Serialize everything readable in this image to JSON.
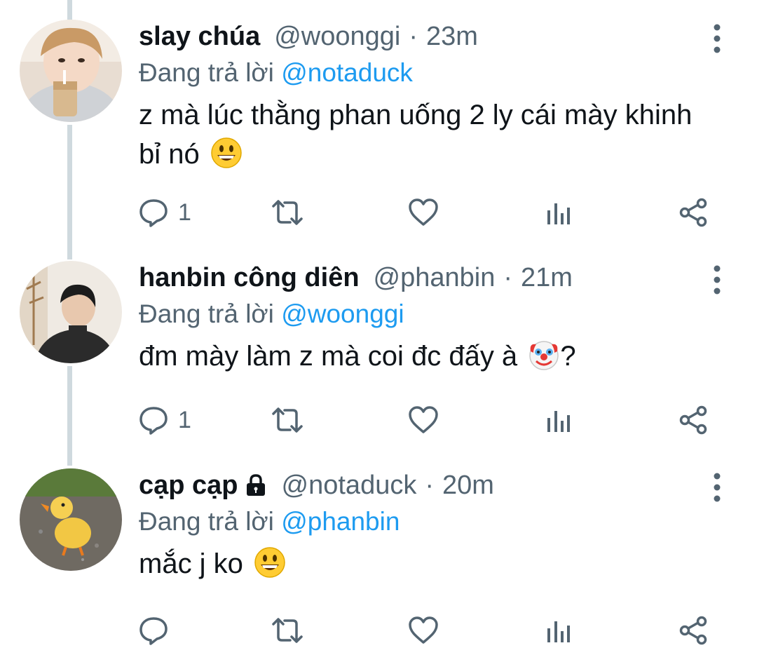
{
  "tweets": [
    {
      "display_name": "slay chúa",
      "handle": "@woonggi",
      "separator": "·",
      "time": "23m",
      "replying_prefix": "Đang trả lời",
      "replying_to": "@notaduck",
      "text": "z mà lúc thằng phan uống 2 ly cái mày khinh bỉ nó",
      "emoji": "grinning-face",
      "locked": false,
      "reply_count": "1"
    },
    {
      "display_name": "hanbin công diên",
      "handle": "@phanbin",
      "separator": "·",
      "time": "21m",
      "replying_prefix": "Đang trả lời",
      "replying_to": "@woonggi",
      "text": "đm mày làm z mà coi đc đấy à",
      "emoji": "clown-face",
      "text_suffix": "?",
      "locked": false,
      "reply_count": "1"
    },
    {
      "display_name": "cạp cạp",
      "handle": "@notaduck",
      "separator": "·",
      "time": "20m",
      "replying_prefix": "Đang trả lời",
      "replying_to": "@phanbin",
      "text": "mắc j ko",
      "emoji": "grinning-face",
      "locked": true,
      "reply_count": ""
    }
  ],
  "colors": {
    "text_primary": "#0f1419",
    "text_secondary": "#536471",
    "mention": "#1d9bf0",
    "thread_line": "#cfd9de",
    "icon": "#536471"
  },
  "icons": [
    "more-vertical-icon",
    "reply-icon",
    "retweet-icon",
    "like-icon",
    "analytics-icon",
    "share-icon",
    "lock-icon"
  ]
}
